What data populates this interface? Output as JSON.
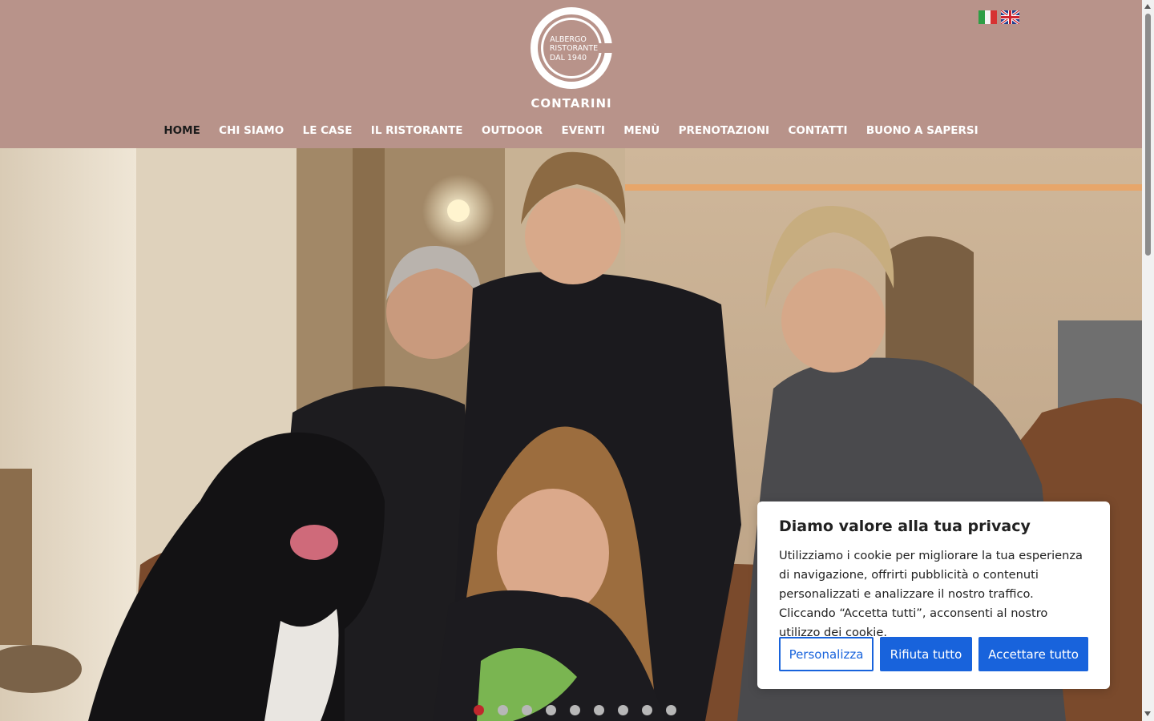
{
  "brand": {
    "logo_line1": "ALBERGO",
    "logo_line2": "RISTORANTE",
    "logo_line3": "DAL 1940",
    "name": "CONTARINI"
  },
  "languages": [
    "it",
    "en"
  ],
  "nav": {
    "items": [
      {
        "label": "HOME",
        "active": true
      },
      {
        "label": "CHI SIAMO"
      },
      {
        "label": "LE CASE"
      },
      {
        "label": "IL RISTORANTE"
      },
      {
        "label": "OUTDOOR"
      },
      {
        "label": "EVENTI"
      },
      {
        "label": "MENÙ"
      },
      {
        "label": "PRENOTAZIONI"
      },
      {
        "label": "CONTATTI"
      },
      {
        "label": "BUONO A SAPERSI"
      }
    ]
  },
  "slider": {
    "total": 9,
    "active_index": 0
  },
  "cookie": {
    "title": "Diamo valore alla tua privacy",
    "text": "Utilizziamo i cookie per migliorare la tua esperienza di navigazione, offrirti pubblicità o contenuti personalizzati e analizzare il nostro traffico. Cliccando “Accetta tutti”, acconsenti al nostro utilizzo dei cookie.",
    "customize_label": "Personalizza",
    "reject_label": "Rifiuta tutto",
    "accept_label": "Accettare tutto"
  },
  "colors": {
    "header_bg": "#b8938a",
    "accent_blue": "#1863dc",
    "active_dot": "#c0282d"
  }
}
